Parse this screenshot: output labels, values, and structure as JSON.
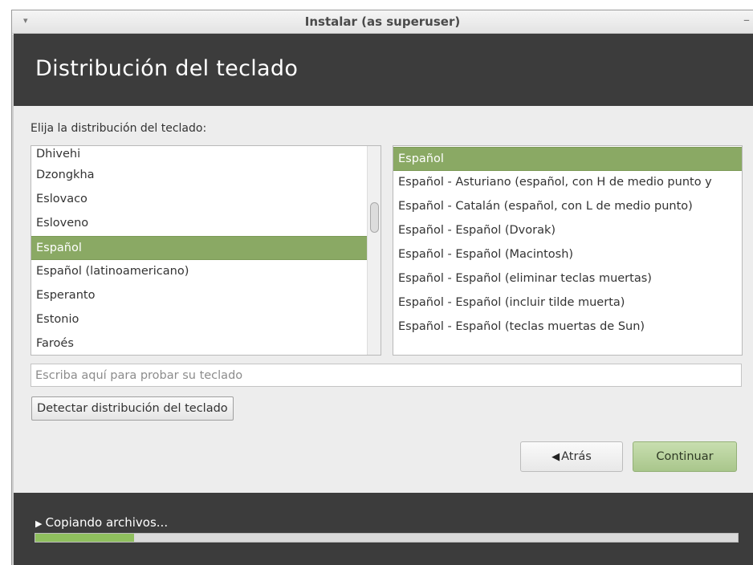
{
  "window": {
    "title": "Instalar (as superuser)",
    "menu_glyph": "▾",
    "minimize_glyph": "–"
  },
  "header": {
    "title": "Distribución del teclado"
  },
  "prompt": "Elija la distribución del teclado:",
  "layouts": {
    "items": [
      {
        "label": "Dhivehi",
        "selected": false
      },
      {
        "label": "Dzongkha",
        "selected": false
      },
      {
        "label": "Eslovaco",
        "selected": false
      },
      {
        "label": "Esloveno",
        "selected": false
      },
      {
        "label": "Español",
        "selected": true
      },
      {
        "label": "Español (latinoamericano)",
        "selected": false
      },
      {
        "label": "Esperanto",
        "selected": false
      },
      {
        "label": "Estonio",
        "selected": false
      },
      {
        "label": "Faroés",
        "selected": false
      }
    ]
  },
  "variants": {
    "items": [
      {
        "label": "Español",
        "selected": true
      },
      {
        "label": "Español - Asturiano (español, con H de medio punto y",
        "selected": false
      },
      {
        "label": "Español - Catalán (español, con L de medio punto)",
        "selected": false
      },
      {
        "label": "Español - Español (Dvorak)",
        "selected": false
      },
      {
        "label": "Español - Español (Macintosh)",
        "selected": false
      },
      {
        "label": "Español - Español (eliminar teclas muertas)",
        "selected": false
      },
      {
        "label": "Español - Español (incluir tilde muerta)",
        "selected": false
      },
      {
        "label": "Español - Español (teclas muertas de Sun)",
        "selected": false
      }
    ]
  },
  "test_input": {
    "placeholder": "Escriba aquí para probar su teclado",
    "value": ""
  },
  "detect_button": {
    "label": "Detectar distribución del teclado"
  },
  "nav": {
    "back_label": "Atrás",
    "back_icon": "left-arrow-icon",
    "continue_label": "Continuar"
  },
  "progress": {
    "label": "Copiando archivos...",
    "expander_glyph": "▶",
    "fraction": 0.14
  },
  "colors": {
    "selection": "#8aa964",
    "continue_button": "#b5d09a",
    "progress_fill": "#8fbf5e",
    "dark_panel": "#3c3c3c"
  }
}
